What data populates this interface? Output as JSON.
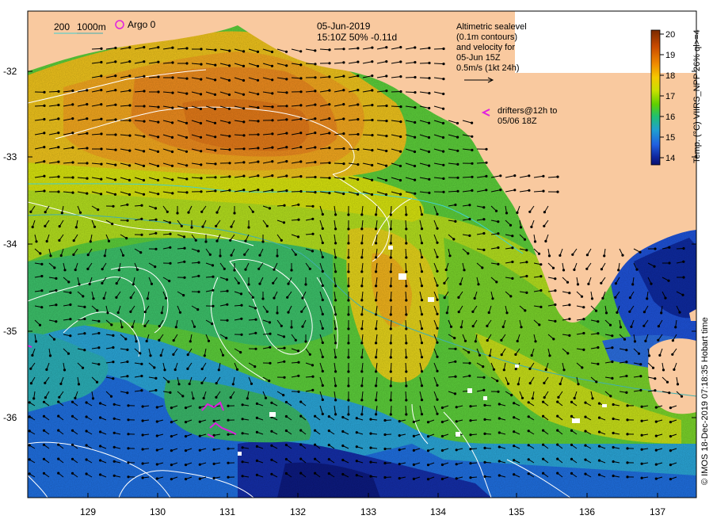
{
  "header": {
    "date": "05-Jun-2019",
    "time_line": "15:10Z  50% -0.11d"
  },
  "legend": {
    "bathy_200": "200",
    "bathy_1000": "1000m",
    "argo": "Argo 0",
    "drifters_line1": "drifters@12h to",
    "drifters_line2": "05/06 18Z",
    "altimetry_lines": [
      "Altimetric sealevel",
      "(0.1m contours)",
      "and velocity for",
      "05-Jun 15Z",
      "0.5m/s (1kt 24h)"
    ]
  },
  "colorbar": {
    "title": "Temp. (°C) VIIRS_NPP 26% ql>=4",
    "ticks": [
      "20",
      "19",
      "18",
      "17",
      "16",
      "15",
      "14"
    ],
    "colors": [
      "#7a2a00",
      "#c84a00",
      "#f08a00",
      "#f5c800",
      "#c8e000",
      "#60d000",
      "#20c070",
      "#20a0d0",
      "#2060e0",
      "#1028a0",
      "#0a1070"
    ]
  },
  "axes": {
    "y_ticks": [
      "-32",
      "-33",
      "-34",
      "-35",
      "-36"
    ],
    "x_ticks": [
      "129",
      "130",
      "131",
      "132",
      "133",
      "134",
      "135",
      "136",
      "137"
    ]
  },
  "credit": "© IMOS 18-Dec-2019 07:18:35 Hobart time",
  "colors": {
    "land": "#f9c99f",
    "contour": "#ffffff",
    "bathy_200": "#40d0d0",
    "bathy_1000": "#40b0b0",
    "drifter": "#e020e0",
    "arrow": "#000000"
  }
}
